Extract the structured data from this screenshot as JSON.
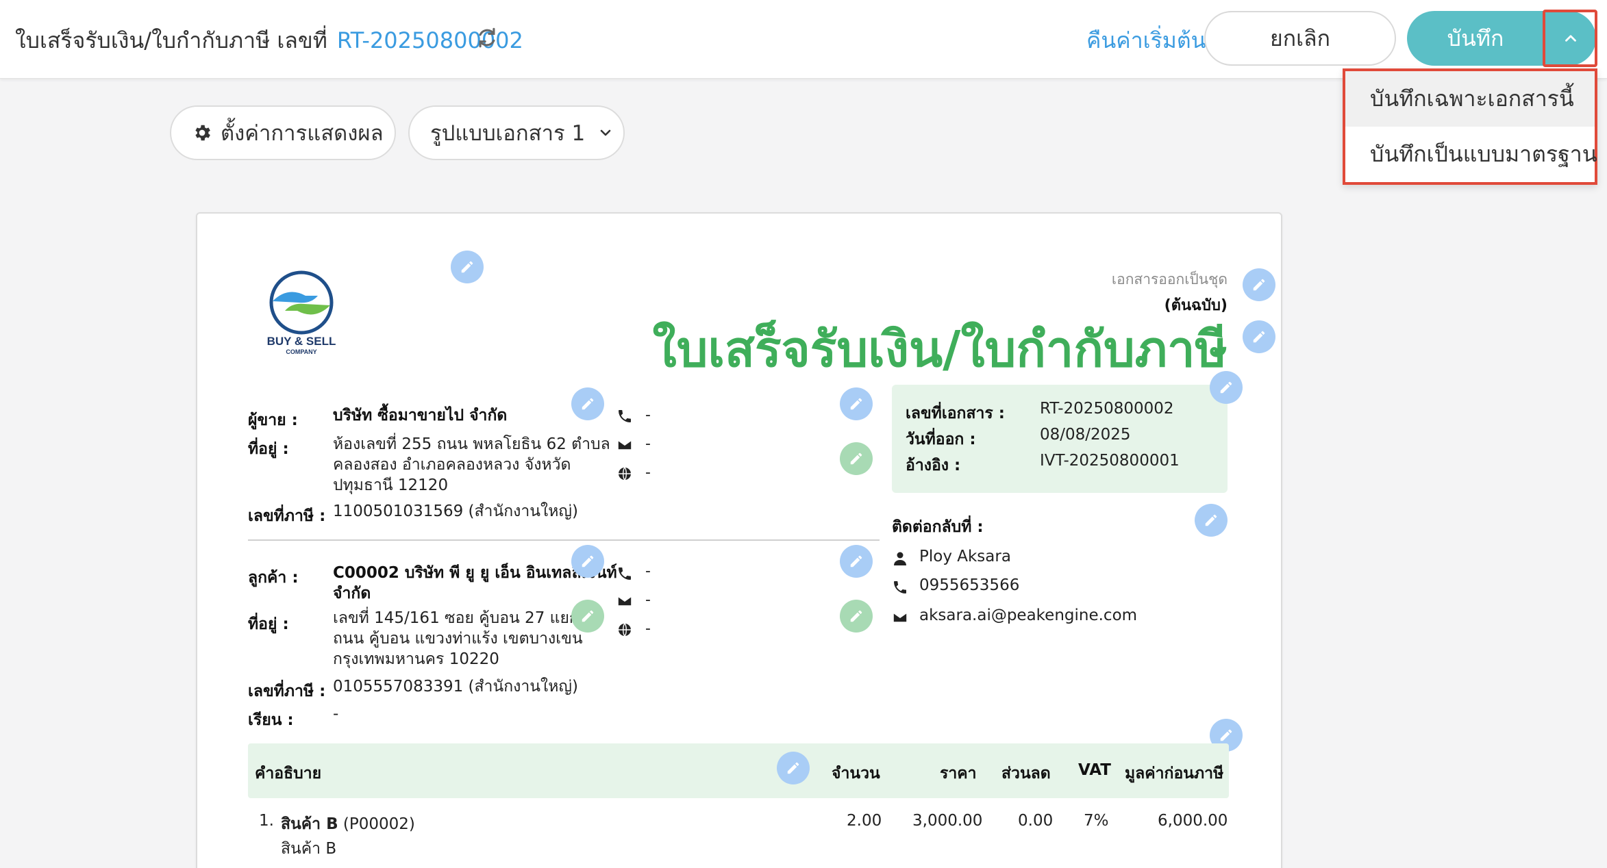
{
  "header": {
    "title_prefix": "ใบเสร็จรับเงิน/ใบกำกับภาษี เลขที่",
    "doc_number": "RT-20250800002",
    "reset_label": "คืนค่าเริ่มต้น",
    "cancel_label": "ยกเลิก",
    "save_label": "บันทึก"
  },
  "save_menu": {
    "items": [
      {
        "label": "บันทึกเฉพาะเอกสารนี้"
      },
      {
        "label": "บันทึกเป็นแบบมาตรฐาน"
      }
    ]
  },
  "toolbar": {
    "settings_label": "ตั้งค่าการแสดงผล",
    "template_label": "รูปแบบเอกสาร 1"
  },
  "document": {
    "logo_line1": "BUY & SELL",
    "logo_line2": "COMPANY",
    "issued_as_set": "เอกสารออกเป็นชุด",
    "original": "(ต้นฉบับ)",
    "title": "ใบเสร็จรับเงิน/ใบกำกับภาษี",
    "seller": {
      "label": "ผู้ขาย :",
      "name": "บริษัท ซื้อมาขายไป จำกัด",
      "address_label": "ที่อยู่ :",
      "address_line1": "ห้องเลขที่ 255 ถนน พหลโยธิน 62 ตำบล",
      "address_line2": "คลองสอง อำเภอคลองหลวง จังหวัด",
      "address_line3": "ปทุมธานี 12120",
      "tax_label": "เลขที่ภาษี :",
      "tax_id": "1100501031569 (สำนักงานใหญ่)",
      "phone": "-",
      "email": "-",
      "web": "-"
    },
    "customer": {
      "label": "ลูกค้า :",
      "name_line1": "C00002 บริษัท พี ยู ยู เอ็น อินเทลลิเจนท์",
      "name_line2": "จำกัด",
      "address_label": "ที่อยู่ :",
      "address_line1": "เลขที่ 145/161     ซอย คู้บอน 27 แยก 7",
      "address_line2": "ถนน คู้บอน  แขวงท่าแร้ง เขตบางเขน",
      "address_line3": "กรุงเทพมหานคร 10220",
      "tax_label": "เลขที่ภาษี :",
      "tax_id": "0105557083391 (สำนักงานใหญ่)",
      "attn_label": "เรียน :",
      "attn": "-",
      "phone": "-",
      "email": "-",
      "web": "-"
    },
    "info": {
      "doc_no_label": "เลขที่เอกสาร :",
      "doc_no": "RT-20250800002",
      "date_label": "วันที่ออก :",
      "date": "08/08/2025",
      "ref_label": "อ้างอิง :",
      "ref": "IVT-20250800001"
    },
    "contact": {
      "label": "ติดต่อกลับที่ :",
      "name": "Ploy Aksara",
      "phone": "0955653566",
      "email": "aksara.ai@peakengine.com"
    },
    "table": {
      "headers": {
        "description": "คำอธิบาย",
        "qty": "จำนวน",
        "price": "ราคา",
        "discount": "ส่วนลด",
        "vat": "VAT",
        "amount": "มูลค่าก่อนภาษี"
      },
      "rows": [
        {
          "index": "1.",
          "name": "สินค้า B",
          "code": "(P00002)",
          "sub": "สินค้า B",
          "qty": "2.00",
          "price": "3,000.00",
          "discount": "0.00",
          "vat": "7%",
          "amount": "6,000.00"
        }
      ]
    }
  },
  "colors": {
    "accent_blue": "#3a9be0",
    "save_teal": "#5bbfc6",
    "title_green": "#3fae5a",
    "highlight_red": "#e04a3a",
    "panel_green": "#e6f4e9"
  }
}
